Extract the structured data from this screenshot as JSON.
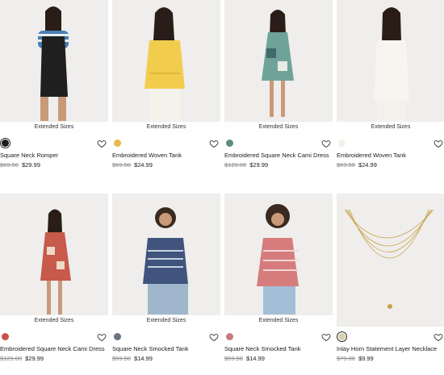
{
  "products": [
    {
      "name": "Square Neck Romper",
      "badge": "Extended Sizes",
      "original_price": "$69.50",
      "sale_price": "$29.99",
      "swatch": "#1b1b1b",
      "swatch_selected": true,
      "image": "woman-striped-tee-black-romper"
    },
    {
      "name": "Embroidered Woven Tank",
      "badge": "Extended Sizes",
      "original_price": "$69.50",
      "sale_price": "$24.99",
      "swatch": "#e9b94a",
      "swatch_selected": false,
      "image": "woman-yellow-embroidered-tank"
    },
    {
      "name": "Embroidered Square Neck Cami Dress",
      "badge": "Extended Sizes",
      "original_price": "$129.00",
      "sale_price": "$29.99",
      "swatch": "#5f8c7d",
      "swatch_selected": false,
      "image": "woman-teal-patchwork-cami-dress"
    },
    {
      "name": "Embroidered Woven Tank",
      "badge": "Extended Sizes",
      "original_price": "$69.50",
      "sale_price": "$24.99",
      "swatch": "#f4f1ea",
      "swatch_selected": false,
      "image": "woman-white-embroidered-tank"
    },
    {
      "name": "Embroidered Square Neck Cami Dress",
      "badge": "Extended Sizes",
      "original_price": "$129.00",
      "sale_price": "$29.99",
      "swatch": "#c8514a",
      "swatch_selected": false,
      "image": "woman-red-patchwork-cami-dress"
    },
    {
      "name": "Square Neck Smocked Tank",
      "badge": "Extended Sizes",
      "original_price": "$59.50",
      "sale_price": "$14.99",
      "swatch": "#6b7280",
      "swatch_selected": false,
      "image": "woman-navy-gingham-smocked-tank"
    },
    {
      "name": "Square Neck Smocked Tank",
      "badge": "Extended Sizes",
      "original_price": "$59.50",
      "sale_price": "$14.99",
      "swatch": "#c97a7a",
      "swatch_selected": false,
      "image": "woman-red-gingham-smocked-tank"
    },
    {
      "name": "Inlay Horn Statement Layer Necklace",
      "badge": "",
      "original_price": "$79.00",
      "sale_price": "$9.99",
      "swatch": "#d8cfae",
      "swatch_selected": true,
      "image": "gold-layered-necklace"
    }
  ],
  "icons": {
    "wishlist": "heart-outline-icon"
  }
}
